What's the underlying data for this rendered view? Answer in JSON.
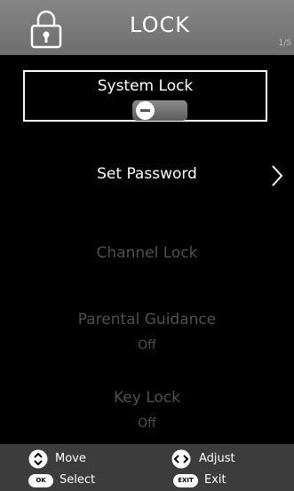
{
  "header": {
    "title": "LOCK",
    "page_indicator": "1/5",
    "icon": "padlock-icon"
  },
  "system_lock": {
    "label": "System Lock",
    "toggle_state": "off",
    "icon": "toggle-switch"
  },
  "menu": {
    "set_password": "Set Password",
    "channel_lock": "Channel Lock",
    "parental_guidance": "Parental Guidance",
    "parental_guidance_value": "Off",
    "key_lock": "Key Lock",
    "key_lock_value": "Off"
  },
  "footer": {
    "move": "Move",
    "adjust": "Adjust",
    "select": "Select",
    "exit": "Exit",
    "ok_key": "OK",
    "exit_key": "EXIT"
  },
  "colors": {
    "header_bg": "#7a7a7a",
    "footer_bg": "#3c3c3c",
    "active_text": "#ffffff",
    "disabled_text": "#4f4f4f"
  }
}
